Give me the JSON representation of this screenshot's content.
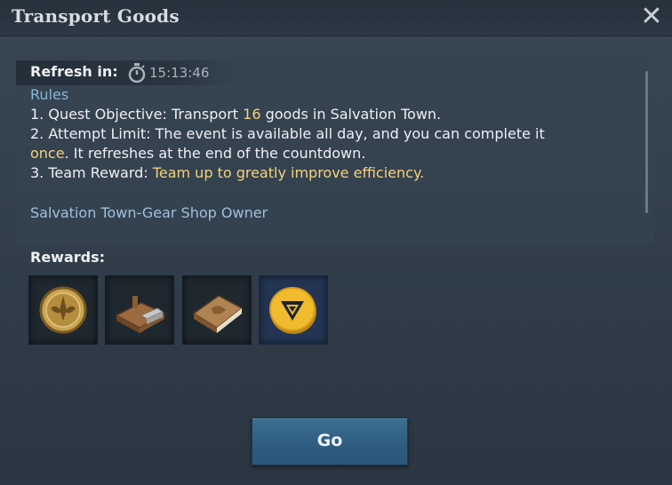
{
  "window": {
    "title": "Transport Goods"
  },
  "refresh": {
    "label": "Refresh in:",
    "time": "15:13:46"
  },
  "rules": {
    "heading": "Rules",
    "line1_prefix": "1. Quest Objective: Transport ",
    "line1_highlight": "16",
    "line1_suffix": " goods in Salvation Town.",
    "line2": "2. Attempt Limit: The event is available all day, and you can complete it",
    "line3_highlight": "once",
    "line3_suffix": ". It refreshes at the end of the countdown.",
    "line4_prefix": "3. Team Reward: ",
    "line4_highlight": "Team up to greatly improve efficiency.",
    "owner": "Salvation Town-Gear Shop Owner"
  },
  "rewards": {
    "label": "Rewards:",
    "items": [
      {
        "icon": "gold-coin-badge-icon"
      },
      {
        "icon": "wood-plank-bracket-icon"
      },
      {
        "icon": "book-icon"
      },
      {
        "icon": "gold-token-icon"
      }
    ]
  },
  "actions": {
    "go_label": "Go"
  },
  "colors": {
    "highlight": "#f4d27a",
    "link_blue": "#86b6d8",
    "button_blue": "#2f5f83"
  }
}
